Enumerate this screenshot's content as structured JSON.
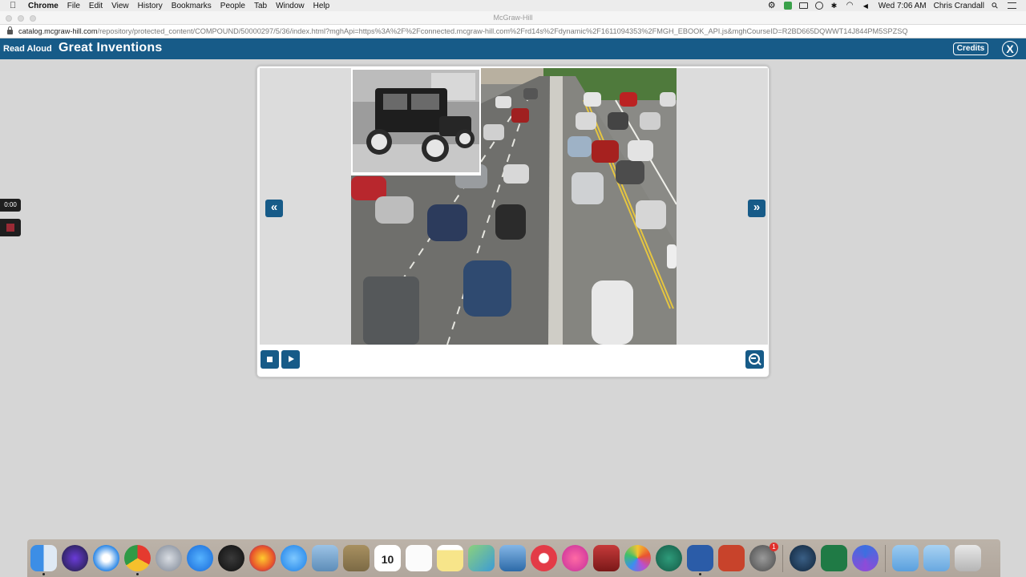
{
  "menubar": {
    "app_name": "Chrome",
    "menus": [
      "File",
      "Edit",
      "View",
      "History",
      "Bookmarks",
      "People",
      "Tab",
      "Window",
      "Help"
    ],
    "clock": "Wed 7:06 AM",
    "user": "Chris Crandall"
  },
  "browser": {
    "window_title": "McGraw-Hill",
    "url_host": "catalog.mcgraw-hill.com",
    "url_path": "/repository/protected_content/COMPOUND/50000297/5/36/index.html?mghApi=https%3A%2F%2Fconnected.mcgraw-hill.com%2Frd14s%2Fdynamic%2F1611094353%2FMGH_EBOOK_API.js&mghCourseID=R2BD665DQWWT14J844PM5SPZSQ"
  },
  "app": {
    "mode_label": "Read Aloud",
    "title": "Great Inventions",
    "credits_label": "Credits",
    "close_label": "X"
  },
  "recorder": {
    "time": "0:00"
  },
  "reader": {
    "prev_label": "«",
    "next_label": "»",
    "image_description_icon": "model-t-car-and-highway-traffic-photo"
  },
  "dock": {
    "calendar_month": "MAR",
    "calendar_day": "10",
    "badge_count": "1"
  },
  "colors": {
    "brand_blue": "#175b88",
    "stage_gray": "#dcdcdc",
    "page_bg": "#d6d6d6"
  }
}
